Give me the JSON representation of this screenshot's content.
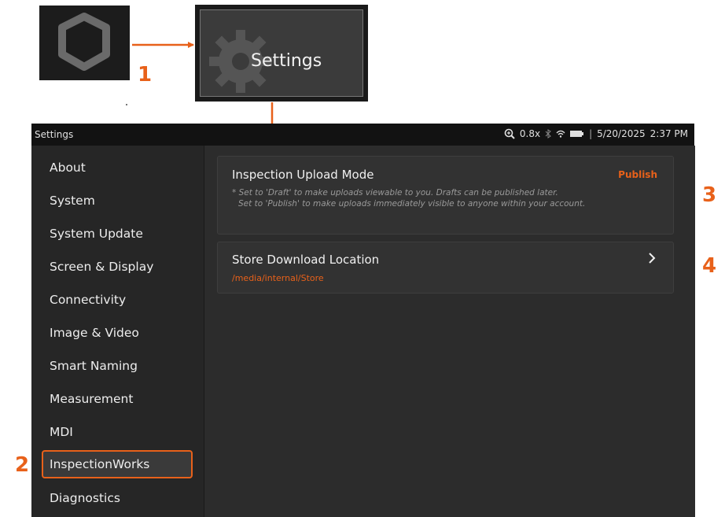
{
  "colors": {
    "accent": "#e8611a",
    "background": "#262626",
    "status_bar": "#121212"
  },
  "callouts": {
    "one": "1",
    "two": "2",
    "three": "3",
    "four": "4"
  },
  "app_icon": {
    "icon": "app-logo-icon"
  },
  "settings_tile": {
    "label": "Settings",
    "icon": "gear-icon"
  },
  "status_bar": {
    "title": "Settings",
    "zoom": "0.8x",
    "date": "5/20/2025",
    "time": "2:37 PM",
    "icons": [
      "zoom-icon",
      "bluetooth-icon",
      "wifi-icon",
      "battery-icon"
    ]
  },
  "sidebar": {
    "items": [
      {
        "label": "About"
      },
      {
        "label": "System"
      },
      {
        "label": "System Update"
      },
      {
        "label": "Screen & Display"
      },
      {
        "label": "Connectivity"
      },
      {
        "label": "Image & Video"
      },
      {
        "label": "Smart Naming"
      },
      {
        "label": "Measurement"
      },
      {
        "label": "MDI"
      },
      {
        "label": "InspectionWorks",
        "selected": true
      },
      {
        "label": "Diagnostics"
      }
    ]
  },
  "settings": {
    "upload_mode": {
      "title": "Inspection Upload Mode",
      "value": "Publish",
      "desc_line1": "* Set to 'Draft' to make uploads viewable to you. Drafts can be published later.",
      "desc_line2": "Set to 'Publish' to make uploads immediately visible to anyone within your account."
    },
    "download_location": {
      "title": "Store Download Location",
      "value": "/media/internal/Store",
      "icon": "chevron-right-icon"
    }
  }
}
